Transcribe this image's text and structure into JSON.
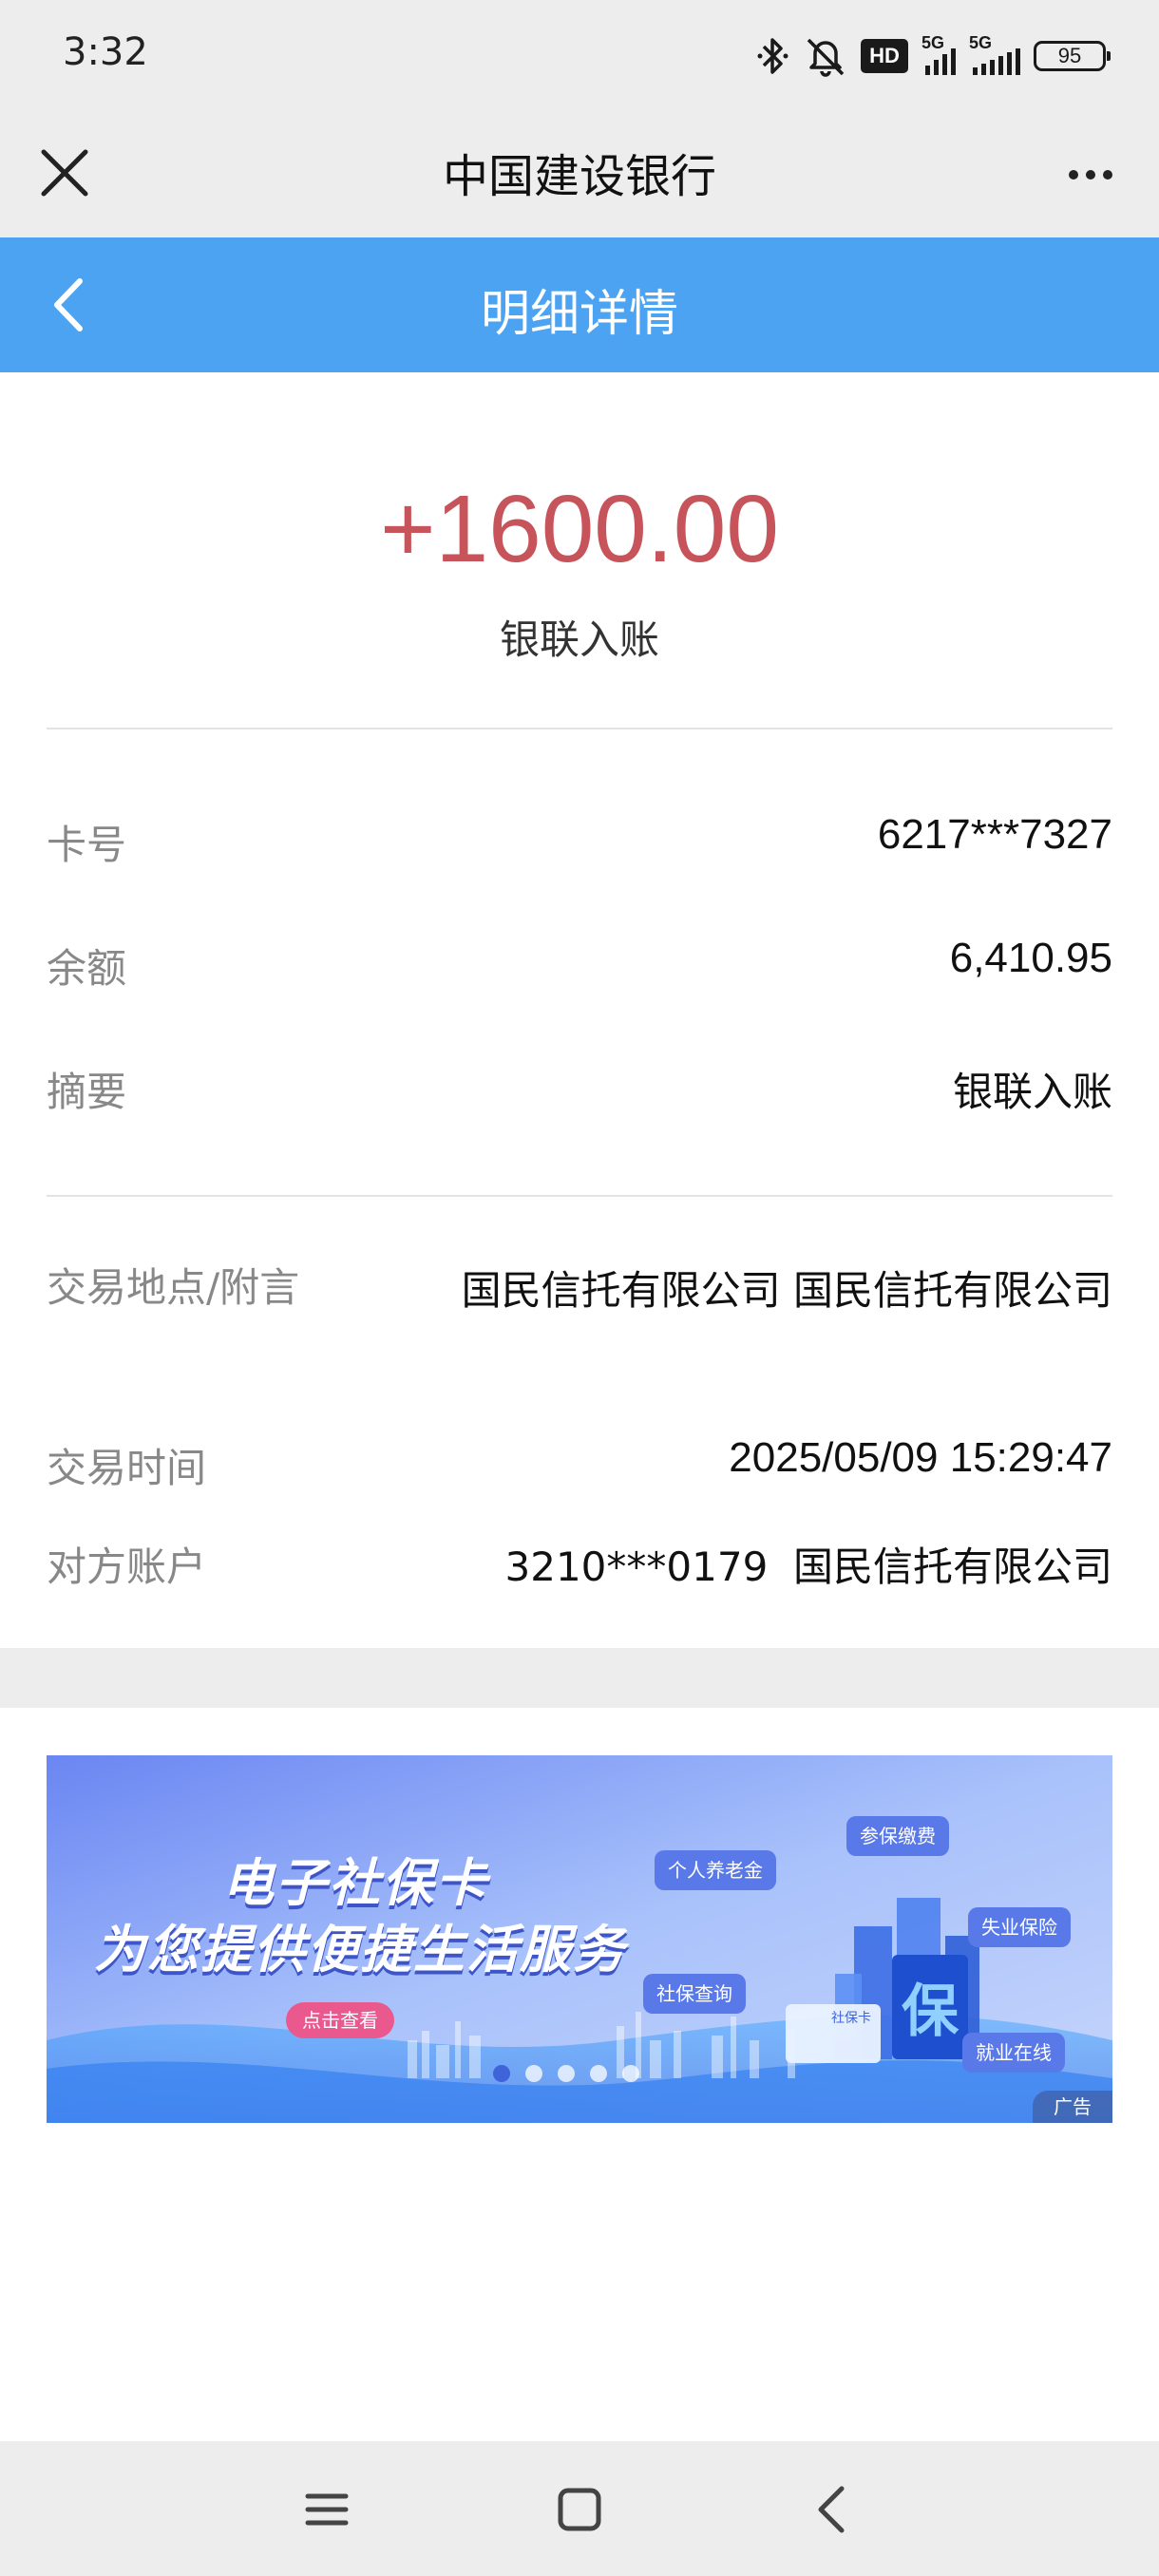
{
  "status_bar": {
    "time": "3:32",
    "hd_label": "HD",
    "signal1_label": "5G",
    "signal2_label": "5G",
    "battery_level": "95"
  },
  "app_bar": {
    "title": "中国建设银行",
    "close_icon": "close-icon",
    "more_icon": "more-icon"
  },
  "header": {
    "title": "明细详情",
    "back_icon": "chevron-left-icon",
    "background_color": "#4ba3f2"
  },
  "transaction": {
    "amount": "+1600.00",
    "amount_color": "#c6545a",
    "type": "银联入账"
  },
  "details": {
    "card_label": "卡号",
    "card_value": "6217***7327",
    "balance_label": "余额",
    "balance_value": "6,410.95",
    "summary_label": "摘要",
    "summary_value": "银联入账",
    "location_label": "交易地点/附言",
    "location_value": "国民信托有限公司 国民信托有限公司",
    "time_label": "交易时间",
    "time_value": "2025/05/09 15:29:47",
    "counterparty_label": "对方账户",
    "counterparty_value": "3210***0179  国民信托有限公司"
  },
  "banner": {
    "line1": "电子社保卡",
    "line2": "为您提供便捷生活服务",
    "button": "点击查看",
    "chip_pension": "个人养老金",
    "chip_payment": "参保缴费",
    "chip_unemployment": "失业保险",
    "chip_query": "社保查询",
    "chip_employment": "就业在线",
    "card_label": "社保卡",
    "ad_label": "广告"
  },
  "nav_bar": {
    "menu_icon": "menu-icon",
    "home_icon": "home-square-icon",
    "back_icon": "back-arrow-icon"
  }
}
